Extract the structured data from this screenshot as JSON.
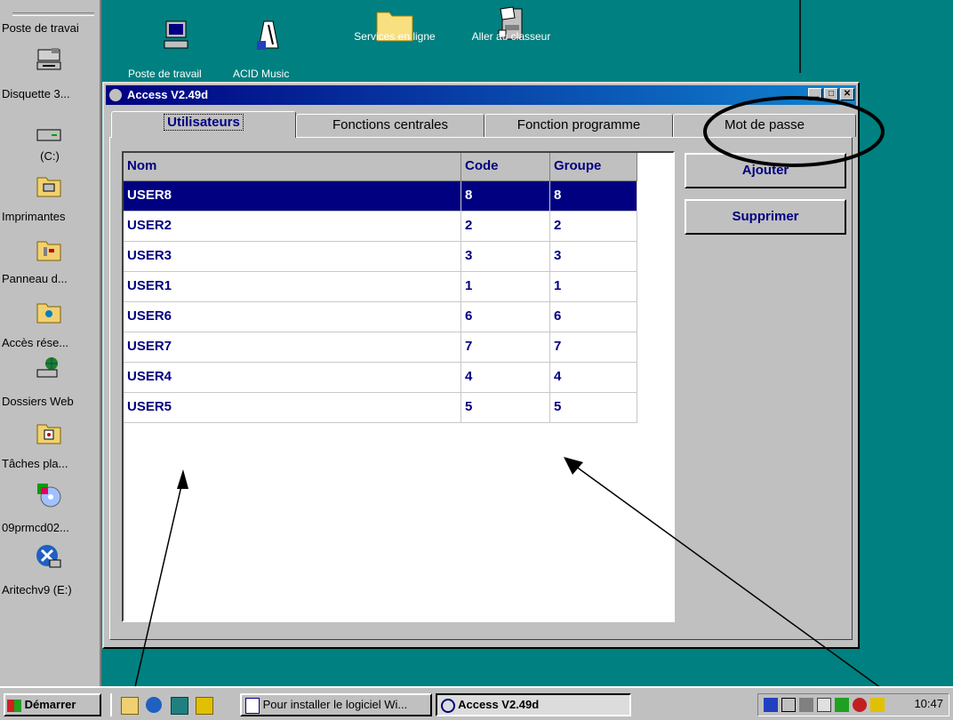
{
  "desktop_sidebar": [
    {
      "label": "Poste de travai",
      "icon": "none"
    },
    {
      "label": "Disquette 3...",
      "icon": "floppy-icon"
    },
    {
      "label": "(C:)",
      "icon": "hard-drive-icon"
    },
    {
      "label": "Imprimantes",
      "icon": "printer-folder-icon"
    },
    {
      "label": "Panneau d...",
      "icon": "control-panel-icon"
    },
    {
      "label": "Accès rése...",
      "icon": "network-folder-icon"
    },
    {
      "label": "Dossiers Web",
      "icon": "web-folder-icon"
    },
    {
      "label": "Tâches pla...",
      "icon": "scheduled-tasks-icon"
    },
    {
      "label": "09prmcd02...",
      "icon": "cd-icon"
    },
    {
      "label": "Aritechv9 (E:)",
      "icon": "drive-icon"
    }
  ],
  "desktop_icons": [
    {
      "label": "Poste de travail"
    },
    {
      "label": "ACID Music"
    },
    {
      "label": "Services en ligne"
    },
    {
      "label": "Aller au classeur"
    }
  ],
  "window": {
    "title": "Access V2.49d",
    "tabs": [
      "Utilisateurs",
      "Fonctions centrales",
      "Fonction programme",
      "Mot de passe"
    ],
    "active_tab": "Utilisateurs",
    "columns": [
      "Nom",
      "Code",
      "Groupe"
    ],
    "rows": [
      {
        "nom": "USER8",
        "code": "8",
        "groupe": "8",
        "selected": true
      },
      {
        "nom": "USER2",
        "code": "2",
        "groupe": "2"
      },
      {
        "nom": "USER3",
        "code": "3",
        "groupe": "3"
      },
      {
        "nom": "USER1",
        "code": "1",
        "groupe": "1"
      },
      {
        "nom": "USER6",
        "code": "6",
        "groupe": "6"
      },
      {
        "nom": "USER7",
        "code": "7",
        "groupe": "7"
      },
      {
        "nom": "USER4",
        "code": "4",
        "groupe": "4"
      },
      {
        "nom": "USER5",
        "code": "5",
        "groupe": "5"
      }
    ],
    "buttons": {
      "add": "Ajouter",
      "delete": "Supprimer"
    }
  },
  "taskbar": {
    "start": "Démarrer",
    "tasks": [
      "Pour installer le logiciel Wi...",
      "Access V2.49d"
    ],
    "clock": "10:47"
  },
  "colors": {
    "desktop": "#008080",
    "title": "#000080",
    "text_accent": "#000080"
  }
}
